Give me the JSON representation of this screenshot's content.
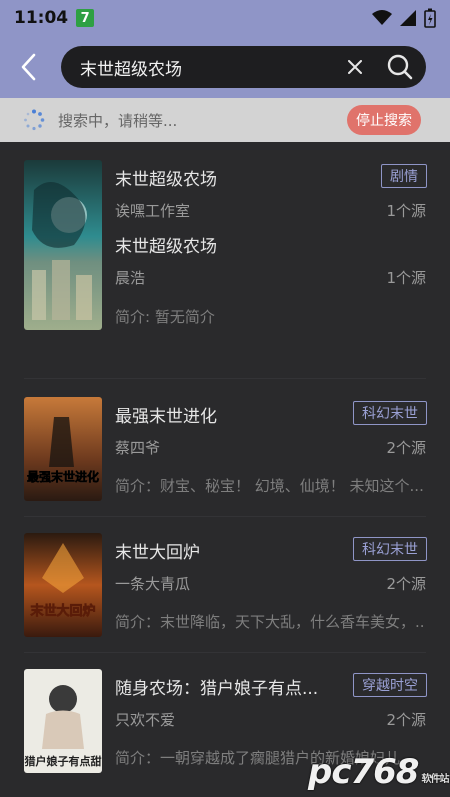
{
  "status_bar": {
    "time": "11:04",
    "notification_badge": "7"
  },
  "search": {
    "query": "末世超级农场",
    "clear_icon": "close-icon",
    "search_icon": "search-icon"
  },
  "banner": {
    "message": "搜索中，请稍等...",
    "stop_label": "停止搜索"
  },
  "results": [
    {
      "title": "末世超级农场",
      "tag": "剧情",
      "author": "诶嘿工作室",
      "sources": "1个源"
    },
    {
      "title": "末世超级农场",
      "author": "晨浩",
      "sources": "1个源",
      "intro": "简介: 暂无简介"
    },
    {
      "title": "最强末世进化",
      "tag": "科幻末世",
      "author": "蔡四爷",
      "sources": "2个源",
      "intro": "简介：财宝、秘宝！ 幻境、仙境！ 未知这个...",
      "cover_text": "最强末世进化"
    },
    {
      "title": "末世大回炉",
      "tag": "科幻末世",
      "author": "一条大青瓜",
      "sources": "2个源",
      "intro": "简介：末世降临，天下大乱，什么香车美女，...",
      "cover_text": "末世大回炉"
    },
    {
      "title": "随身农场：猎户娘子有点...",
      "tag": "穿越时空",
      "author": "只欢不爱",
      "sources": "2个源",
      "intro": "简介：一朝穿越成了瘸腿猎户的新婚娘妇儿...",
      "cover_text": "猎户娘子有点甜"
    }
  ],
  "watermark": {
    "brand": "pc768",
    "sub": "软件站"
  },
  "colors": {
    "accent": "#8f95c7",
    "stop": "#e0736b",
    "background": "#2a2a2c"
  }
}
